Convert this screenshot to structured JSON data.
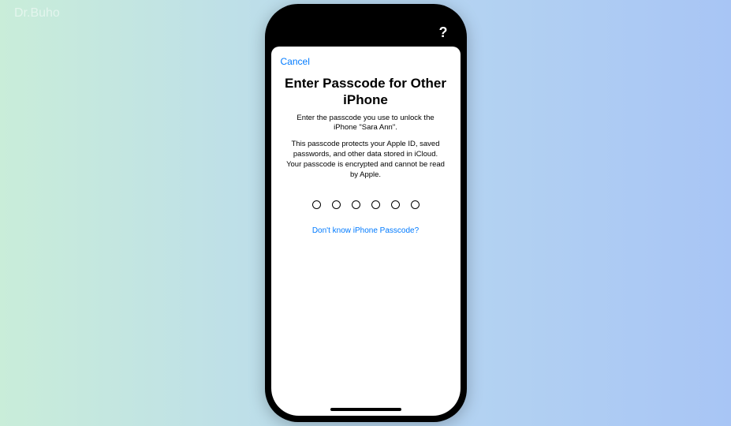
{
  "watermark": "Dr.Buho",
  "statusbar": {
    "help_icon": "?"
  },
  "modal": {
    "cancel_label": "Cancel",
    "title": "Enter Passcode for Other iPhone",
    "subtitle": "Enter the passcode you use to unlock the iPhone \"Sara Ann\".",
    "body": "This passcode protects your Apple ID, saved passwords, and other data stored in iCloud. Your passcode is encrypted and cannot be read by Apple.",
    "passcode_length": 6,
    "forgot_label": "Don't know iPhone Passcode?"
  }
}
